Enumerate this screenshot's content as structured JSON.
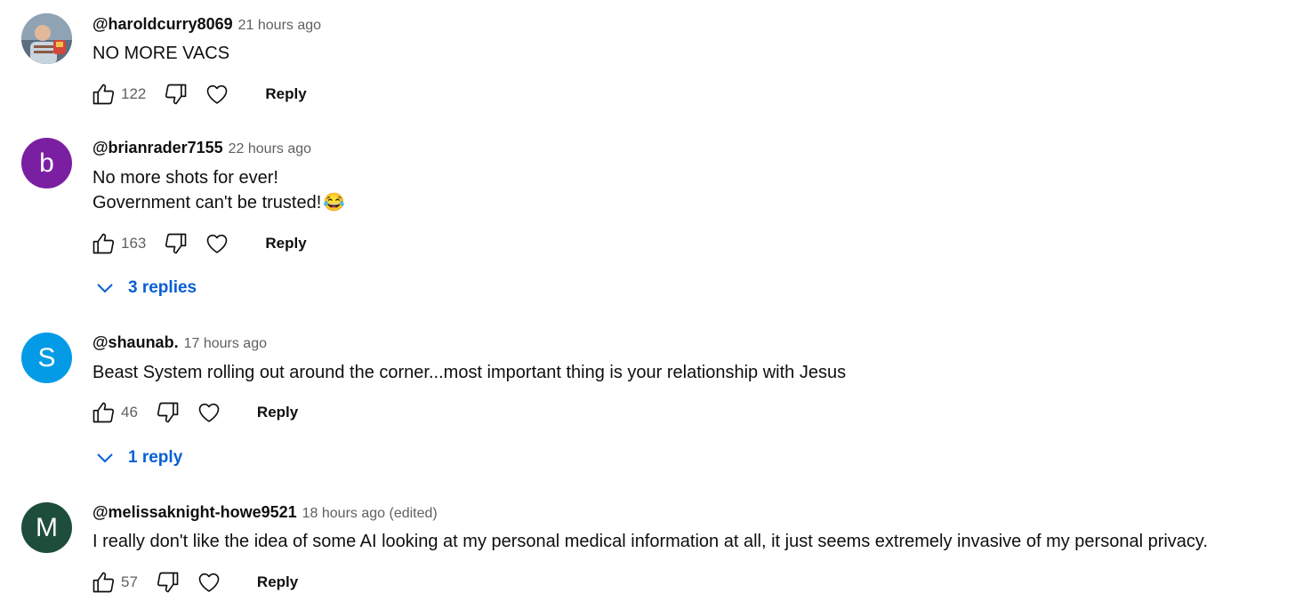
{
  "comments": [
    {
      "author": "@haroldcurry8069",
      "time": "21 hours ago",
      "text": [
        "NO MORE VACS"
      ],
      "likes": "122",
      "reply_label": "Reply",
      "avatar": {
        "type": "photo",
        "color": "#7a8a9a"
      }
    },
    {
      "author": "@brianrader7155",
      "time": "22 hours ago",
      "text": [
        "No more shots for ever!",
        "Government can't  be trusted!"
      ],
      "emoji": "😂",
      "likes": "163",
      "reply_label": "Reply",
      "replies_label": "3 replies",
      "avatar": {
        "type": "letter",
        "letter": "b",
        "color": "#7b1fa2"
      }
    },
    {
      "author": "@shaunab.",
      "time": "17 hours ago",
      "text": [
        "Beast System rolling out around the corner...most important thing is your relationship with Jesus"
      ],
      "likes": "46",
      "reply_label": "Reply",
      "replies_label": "1 reply",
      "avatar": {
        "type": "letter",
        "letter": "S",
        "color": "#039be5"
      }
    },
    {
      "author": "@melissaknight-howe9521",
      "time": "18 hours ago (edited)",
      "text": [
        "I really don't like the idea of some AI looking at my personal medical information at all, it just seems extremely invasive of my personal privacy."
      ],
      "likes": "57",
      "reply_label": "Reply",
      "avatar": {
        "type": "letter",
        "letter": "M",
        "color": "#1e4d3b"
      }
    }
  ],
  "icons": {
    "like": "thumbs-up-icon",
    "dislike": "thumbs-down-icon",
    "heart": "heart-icon",
    "chevron": "chevron-down-icon"
  },
  "colors": {
    "link_blue": "#065fd4",
    "secondary_text": "#606060"
  }
}
